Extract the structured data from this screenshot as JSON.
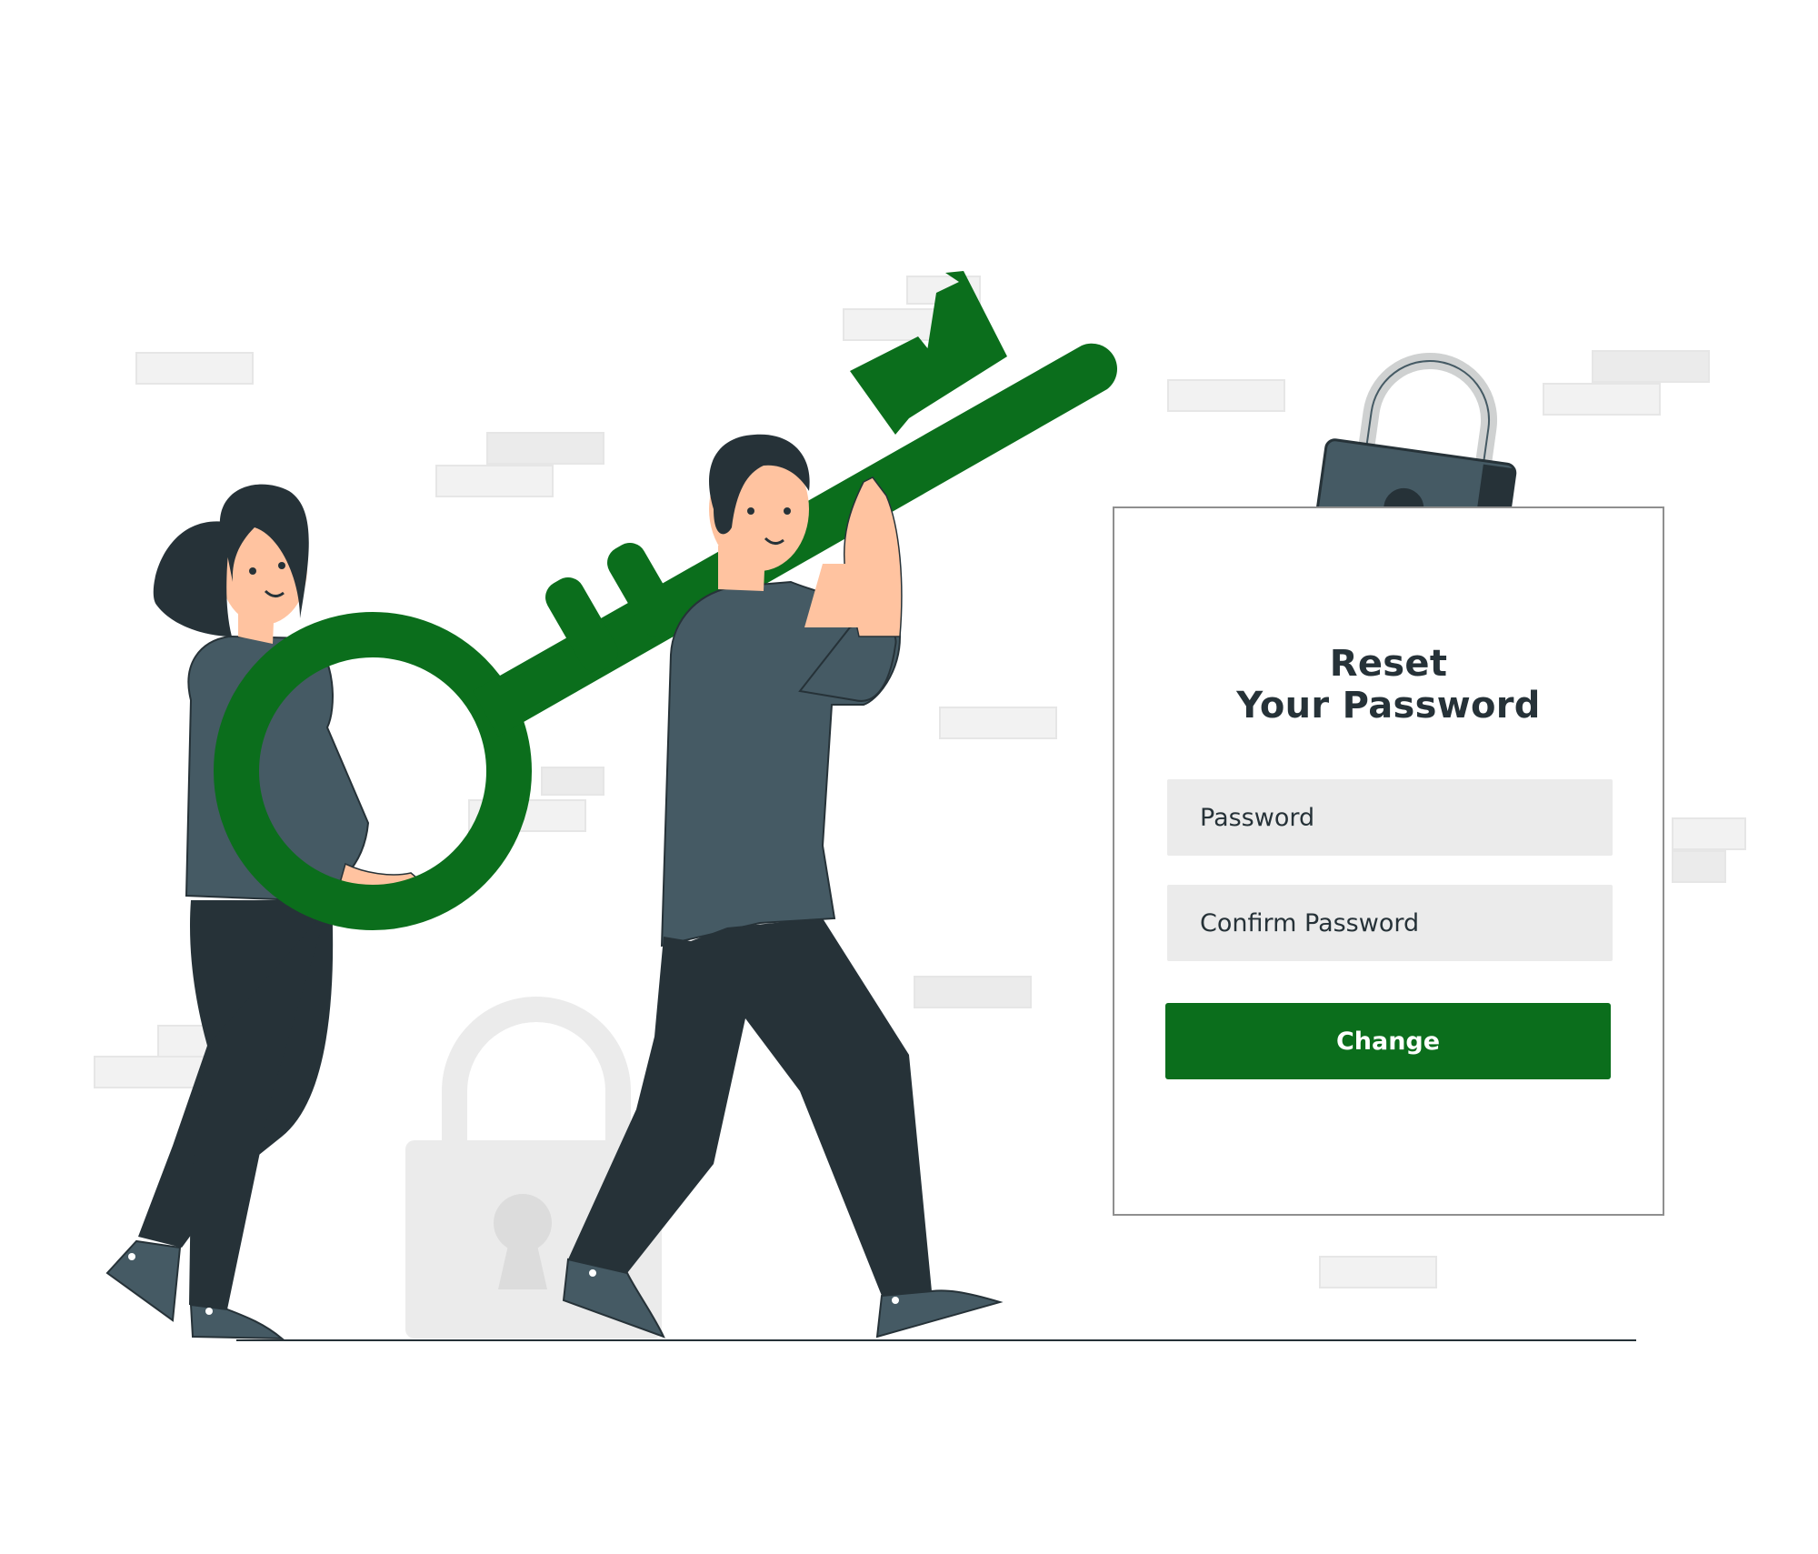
{
  "card": {
    "title_line1": "Reset",
    "title_line2": "Your Password",
    "password_placeholder": "Password",
    "confirm_placeholder": "Confirm Password",
    "submit_label": "Change"
  },
  "colors": {
    "accent": "#0b6e1c",
    "dark": "#263238",
    "shirt": "#455a64",
    "skin": "#ffc3a0",
    "field_bg": "#ebebeb"
  },
  "icons": [
    "key-icon",
    "padlock-icon",
    "faded-padlock-icon"
  ]
}
